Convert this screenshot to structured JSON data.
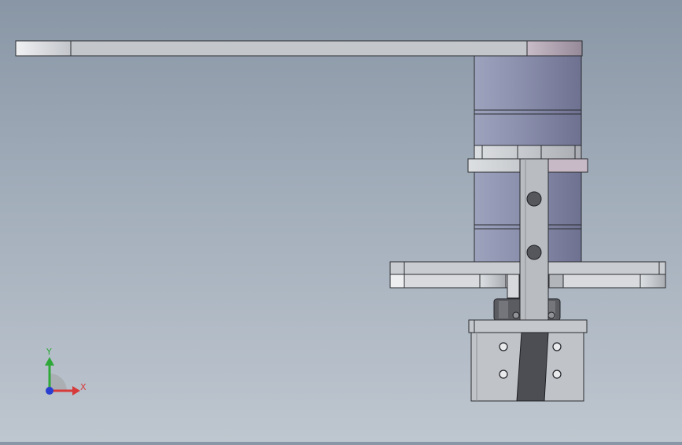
{
  "viewport": {
    "background_top": "#8996a5",
    "background_bottom": "#bec6cf",
    "model": {
      "parts": [
        "horizontal-arm",
        "motor-cylinder",
        "mounting-plate",
        "bracket-flange",
        "vertical-slider",
        "guide-plate",
        "clamp-block",
        "gripper-block"
      ],
      "colors": {
        "steel": "#c6c9ce",
        "cylinder": "#8c90ac",
        "dark": "#4f5054",
        "outline": "#2a2c30"
      }
    }
  },
  "triad": {
    "x_label": "X",
    "y_label": "Y",
    "x_color": "#d63a3a",
    "y_color": "#2fa83a",
    "z_color": "#2a3fd0"
  }
}
